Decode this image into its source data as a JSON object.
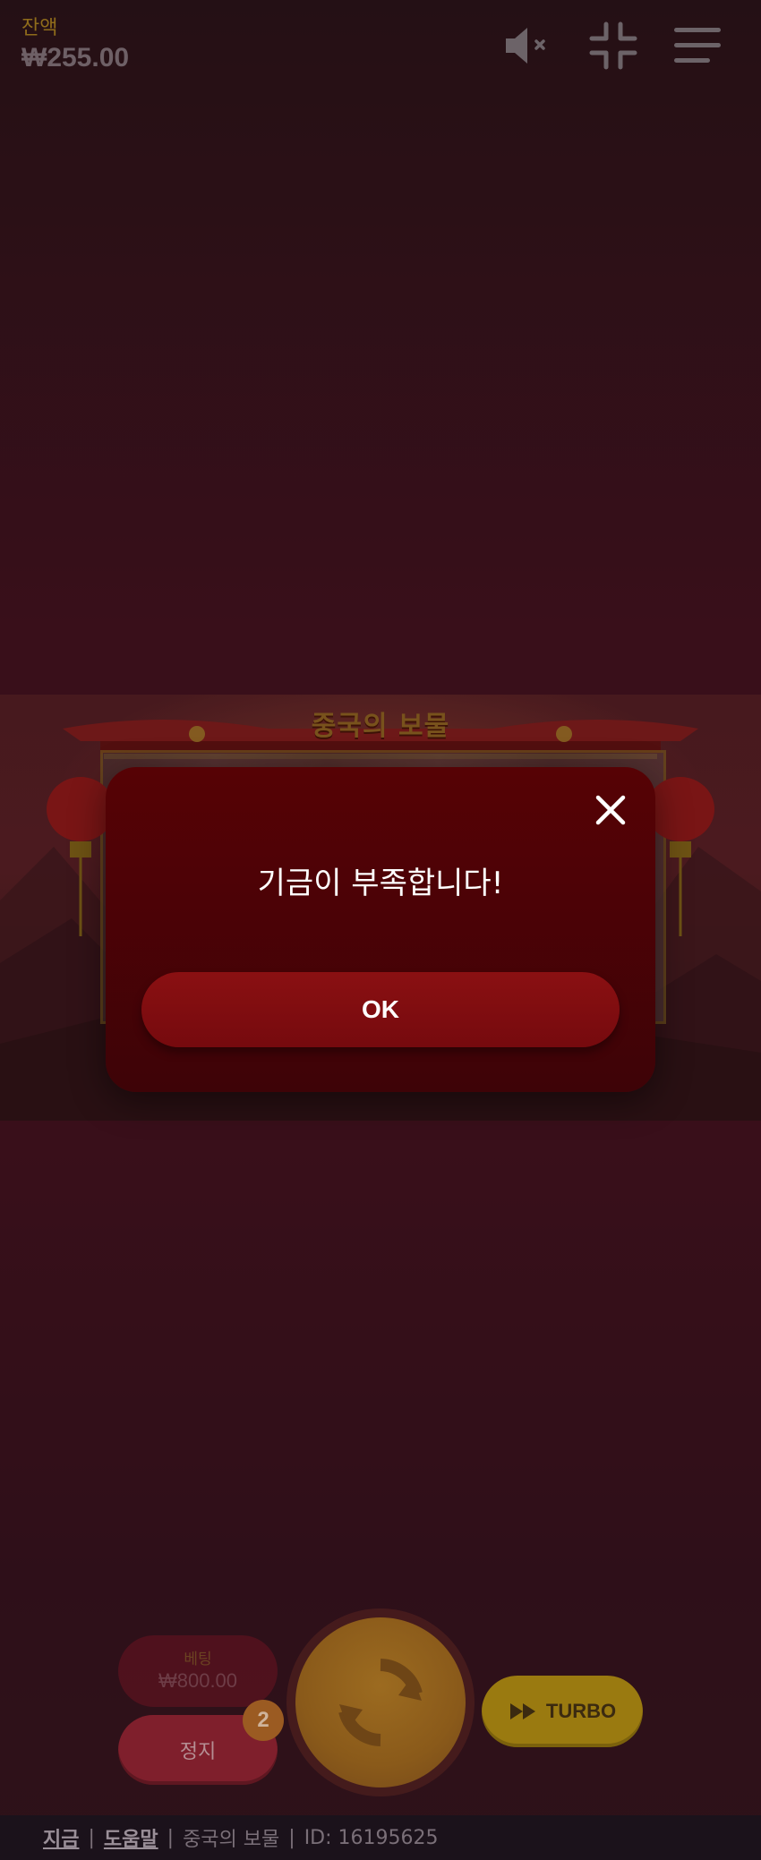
{
  "top_bar": {
    "balance_label": "잔액",
    "balance_value": "₩255.00",
    "sound_icon": "speaker-muted-icon",
    "fullscreen_icon": "exit-fullscreen-icon",
    "menu_icon": "hamburger-menu-icon"
  },
  "game": {
    "title": "중국의 보물"
  },
  "modal": {
    "message": "기금이 부족합니다!",
    "ok_label": "OK",
    "close_icon": "close-icon"
  },
  "controls": {
    "bet_label": "베팅",
    "bet_value": "₩800.00",
    "stop_label": "정지",
    "auto_spins_count": "2",
    "spin_icon": "spin-arrows-icon",
    "turbo_label": "TURBO",
    "turbo_icon": "fast-forward-icon"
  },
  "footer": {
    "link_now": "지금",
    "link_help": "도움말",
    "game_name": "중국의 보물",
    "id_text": "ID: 16195625",
    "separator": "|"
  },
  "colors": {
    "background": "#4a1422",
    "modal_bg": "#560205",
    "ok_button": "#8a1012",
    "gold_accent": "#b88b23",
    "turbo_button": "#9a7a10"
  }
}
